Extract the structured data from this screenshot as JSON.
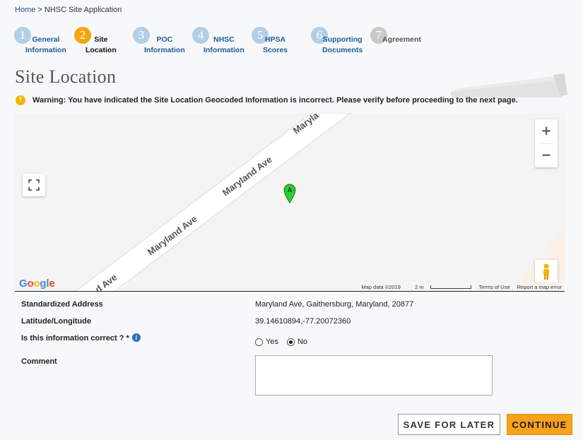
{
  "breadcrumb": {
    "home": "Home",
    "separator": ">",
    "current": "NHSC Site Application"
  },
  "steps": [
    {
      "num": "1",
      "line1": "General",
      "line2": "Information",
      "state": "done"
    },
    {
      "num": "2",
      "line1": "Site",
      "line2": "Location",
      "state": "active"
    },
    {
      "num": "3",
      "line1": "POC",
      "line2": "Information",
      "state": "done"
    },
    {
      "num": "4",
      "line1": "NHSC",
      "line2": "Information",
      "state": "done"
    },
    {
      "num": "5",
      "line1": "HPSA",
      "line2": "Scores",
      "state": "done"
    },
    {
      "num": "6",
      "line1": "Supporting",
      "line2": "Documents",
      "state": "done"
    },
    {
      "num": "7",
      "line1": "Agreement",
      "line2": "",
      "state": "disabled"
    }
  ],
  "page_title": "Site Location",
  "warning": {
    "icon": "exclamation-icon",
    "text": "Warning: You have indicated the Site Location Geocoded Information is incorrect. Please verify before proceeding to the next page."
  },
  "map": {
    "road_labels": [
      "Maryla",
      "Maryland Ave",
      "Maryland Ave",
      "d Ave"
    ],
    "marker_label": "A",
    "zoom_in": "+",
    "zoom_out": "−",
    "google_logo": "Google",
    "map_data": "Map data ©2019",
    "scale": "2 m",
    "terms": "Terms of Use",
    "report": "Report a map error"
  },
  "form": {
    "address_label": "Standardized Address",
    "address_value": "Maryland Ave, Gaithersburg, Maryland, 20877",
    "latlng_label": "Latitude/Longitude",
    "latlng_value": "39.14610894,-77.20072360",
    "correct_label": "Is this information correct ? *",
    "yes_label": "Yes",
    "no_label": "No",
    "selected": "No",
    "comment_label": "Comment",
    "comment_value": ""
  },
  "buttons": {
    "save": "SAVE FOR LATER",
    "continue": "CONTINUE"
  },
  "colors": {
    "accent": "#f7a21b",
    "step_done": "#b3cfe6",
    "step_active": "#f2a60f",
    "link": "#1c4f8c",
    "marker": "#2ecc2e"
  }
}
